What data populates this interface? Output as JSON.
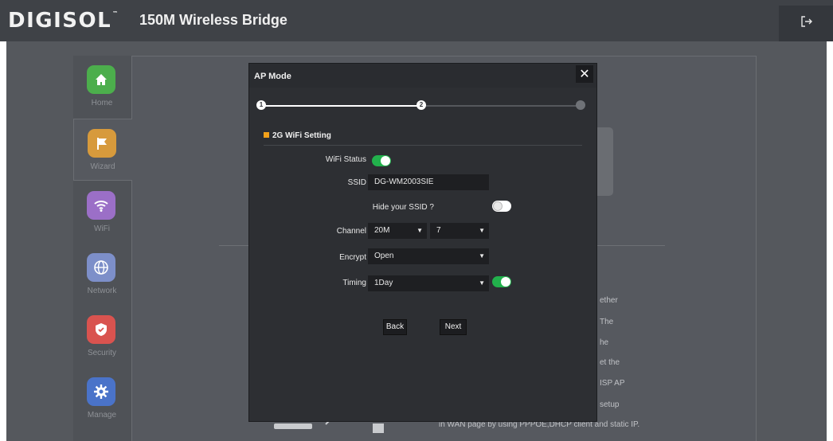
{
  "header": {
    "logo_text": "DIGISOL",
    "logo_mark": "™",
    "title": "150M Wireless Bridge",
    "logout_icon": "logout-icon"
  },
  "sidebar": {
    "items": [
      {
        "label": "Home",
        "icon": "home-icon",
        "color": "#4cae4c",
        "active": false
      },
      {
        "label": "Wizard",
        "icon": "flag-icon",
        "color": "#d79a3c",
        "active": true
      },
      {
        "label": "WiFi",
        "icon": "wifi-icon",
        "color": "#9b6fc7",
        "active": false
      },
      {
        "label": "Network",
        "icon": "globe-icon",
        "color": "#7d8fc9",
        "active": false
      },
      {
        "label": "Security",
        "icon": "shield-icon",
        "color": "#d9534f",
        "active": false
      },
      {
        "label": "Manage",
        "icon": "gear-icon",
        "color": "#4a73c9",
        "active": false
      }
    ]
  },
  "background_text": {
    "lines": [
      "ether",
      "The",
      "he",
      "et the",
      "ISP AP",
      "setup",
      "in WAN page by using PPPOE,DHCP client and static IP."
    ]
  },
  "modal": {
    "title": "AP Mode",
    "close_label": "✕",
    "steps": [
      {
        "label": "1",
        "state": "done"
      },
      {
        "label": "2",
        "state": "current"
      },
      {
        "label": "",
        "state": "pending"
      }
    ],
    "section_title": "2G WiFi Setting",
    "wifi_status_label": "WiFi Status",
    "wifi_status_on": true,
    "ssid_label": "SSID",
    "ssid_value": "DG-WM2003SIE",
    "hide_ssid_label": "Hide your SSID ?",
    "hide_ssid_on": false,
    "channel_label": "Channel",
    "channel_width_value": "20M",
    "channel_value": "7",
    "encrypt_label": "Encrypt",
    "encrypt_value": "Open",
    "timing_label": "Timing",
    "timing_value": "1Day",
    "timing_on": true,
    "back_label": "Back",
    "next_label": "Next"
  },
  "colors": {
    "accent_green": "#22b14c",
    "section_marker": "#f3a11a",
    "topbar": "#3f4247",
    "modal_bg": "#2d2f33"
  }
}
